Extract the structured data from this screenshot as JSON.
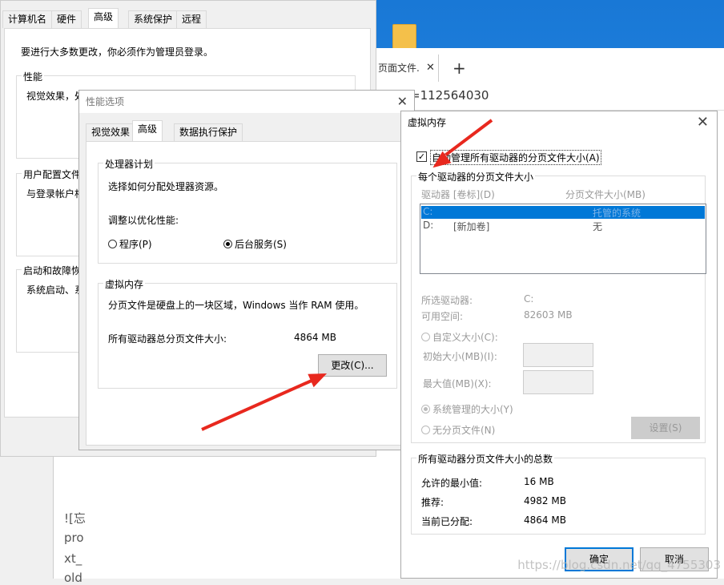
{
  "desktop": {
    "browser_tab": "页面文件.",
    "url_text": "=112564030"
  },
  "sysprops": {
    "tabs": [
      "计算机名",
      "硬件",
      "高级",
      "系统保护",
      "远程"
    ],
    "notice": "要进行大多数更改，你必须作为管理员登录。",
    "perf_label": "性能",
    "perf_text": "视觉效果，处",
    "profile_label": "用户配置文件",
    "profile_text": "与登录帐户相",
    "startup_label": "启动和故障恢",
    "startup_text": "系统启动、系",
    "bg_text": [
      "![忘",
      "pro",
      "xt_",
      "old"
    ]
  },
  "perf_options": {
    "title": "性能选项",
    "tabs": [
      "视觉效果",
      "高级",
      "数据执行保护"
    ],
    "cpu_group": "处理器计划",
    "cpu_desc": "选择如何分配处理器资源。",
    "optimize_label": "调整以优化性能:",
    "radio_programs": "程序(P)",
    "radio_services": "后台服务(S)",
    "vm_group": "虚拟内存",
    "vm_desc": "分页文件是硬盘上的一块区域，Windows 当作 RAM 使用。",
    "vm_total_label": "所有驱动器总分页文件大小:",
    "vm_total_value": "4864 MB",
    "change_button": "更改(C)..."
  },
  "virtual_memory": {
    "title": "虚拟内存",
    "auto_manage": "自动管理所有驱动器的分页文件大小(A)",
    "per_drive_group": "每个驱动器的分页文件大小",
    "col_drive": "驱动器 [卷标](D)",
    "col_size": "分页文件大小(MB)",
    "drives": [
      {
        "drive": "C:",
        "label": "",
        "size": "托管的系统"
      },
      {
        "drive": "D:",
        "label": "[新加卷]",
        "size": "无"
      }
    ],
    "selected_drive_label": "所选驱动器:",
    "selected_drive_value": "C:",
    "free_space_label": "可用空间:",
    "free_space_value": "82603 MB",
    "custom_size": "自定义大小(C):",
    "initial_size": "初始大小(MB)(I):",
    "max_size": "最大值(MB)(X):",
    "system_managed": "系统管理的大小(Y)",
    "no_paging": "无分页文件(N)",
    "set_button": "设置(S)",
    "totals_group": "所有驱动器分页文件大小的总数",
    "min_allowed_label": "允许的最小值:",
    "min_allowed_value": "16 MB",
    "recommended_label": "推荐:",
    "recommended_value": "4982 MB",
    "current_label": "当前已分配:",
    "current_value": "4864 MB",
    "ok_button": "确定",
    "cancel_button": "取消"
  },
  "watermark": "https://blog.csdn.net/qq_4755303",
  "colors": {
    "arrow": "#e8281e",
    "selection": "#0078d7",
    "desktop": "#1978d6"
  }
}
